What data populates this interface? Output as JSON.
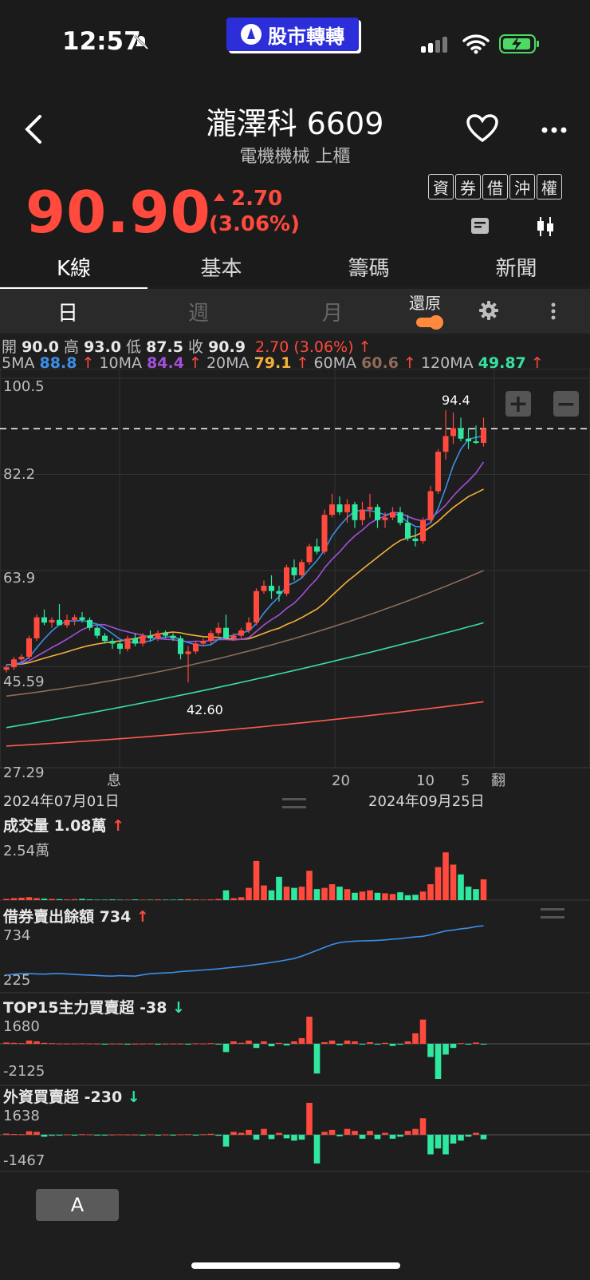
{
  "status_bar": {
    "time": "12:57"
  },
  "brand": {
    "text": "股市轉轉"
  },
  "stock": {
    "name_code": "瀧澤科 6609",
    "industry_market": "電機機械 上櫃",
    "price": "90.90",
    "change": "2.70",
    "change_pct": "(3.06%)"
  },
  "quick_tags": [
    "資",
    "券",
    "借",
    "沖",
    "權"
  ],
  "tabs": [
    "K線",
    "基本",
    "籌碼",
    "新聞"
  ],
  "period_tabs": [
    "日",
    "週",
    "月"
  ],
  "restore_label": "還原",
  "ohlc": {
    "open_label": "開",
    "open": "90.0",
    "high_label": "高",
    "high": "93.0",
    "low_label": "低",
    "low": "87.5",
    "close_label": "收",
    "close": "90.9",
    "change": "2.70 (3.06%)"
  },
  "ma": [
    {
      "label": "5MA",
      "value": "88.8",
      "color": "#3b8fe8"
    },
    {
      "label": "10MA",
      "value": "84.4",
      "color": "#a54fdc"
    },
    {
      "label": "20MA",
      "value": "79.1",
      "color": "#f4b13a"
    },
    {
      "label": "60MA",
      "value": "60.6",
      "color": "#8c6b58"
    },
    {
      "label": "120MA",
      "value": "49.87",
      "color": "#38e0a0"
    }
  ],
  "colors": {
    "up": "#ff4a3d",
    "down": "#2fe8a0"
  },
  "chart_data": [
    {
      "type": "candlestick",
      "y_ticks": [
        "100.5",
        "82.2",
        "63.9",
        "45.59",
        "27.29"
      ],
      "ylim": [
        27.29,
        100.5
      ],
      "x_labels": [
        "息",
        "20",
        "10",
        "5",
        "翻"
      ],
      "date_start": "2024年07月01日",
      "date_end": "2024年09月25日",
      "annotations": {
        "high": "94.4",
        "low": "42.60"
      },
      "candles": [
        [
          45.0,
          46.0,
          44.5,
          45.5
        ],
        [
          45.5,
          47.5,
          45.0,
          47.0
        ],
        [
          47.0,
          48.0,
          46.5,
          47.5
        ],
        [
          47.5,
          51.5,
          47.0,
          51.0
        ],
        [
          51.0,
          55.5,
          50.5,
          55.0
        ],
        [
          55.0,
          56.5,
          53.5,
          54.0
        ],
        [
          54.0,
          55.0,
          53.0,
          54.5
        ],
        [
          54.5,
          57.5,
          53.5,
          53.5
        ],
        [
          53.5,
          55.5,
          53.0,
          54.5
        ],
        [
          54.5,
          55.5,
          53.5,
          55.0
        ],
        [
          55.0,
          56.0,
          54.0,
          54.5
        ],
        [
          54.5,
          55.0,
          52.5,
          53.0
        ],
        [
          53.0,
          53.5,
          51.0,
          51.5
        ],
        [
          51.5,
          52.0,
          50.0,
          50.5
        ],
        [
          50.5,
          51.0,
          49.0,
          50.0
        ],
        [
          50.0,
          50.5,
          48.0,
          49.0
        ],
        [
          49.0,
          51.5,
          48.5,
          51.0
        ],
        [
          51.0,
          52.0,
          49.5,
          50.0
        ],
        [
          50.0,
          52.0,
          49.5,
          51.5
        ],
        [
          51.5,
          52.5,
          50.5,
          51.0
        ],
        [
          51.0,
          52.5,
          50.5,
          52.0
        ],
        [
          52.0,
          52.5,
          51.0,
          51.5
        ],
        [
          51.5,
          52.0,
          50.5,
          51.0
        ],
        [
          51.0,
          51.5,
          47.0,
          48.0
        ],
        [
          48.0,
          49.5,
          42.6,
          48.5
        ],
        [
          48.5,
          50.5,
          48.0,
          50.0
        ],
        [
          50.0,
          51.0,
          49.5,
          50.5
        ],
        [
          50.5,
          52.5,
          50.0,
          52.0
        ],
        [
          52.0,
          54.0,
          51.5,
          53.0
        ],
        [
          53.0,
          55.5,
          52.5,
          51.0
        ],
        [
          51.0,
          52.0,
          50.5,
          51.5
        ],
        [
          51.5,
          53.0,
          51.0,
          52.5
        ],
        [
          52.5,
          55.0,
          52.0,
          54.0
        ],
        [
          54.0,
          60.5,
          53.5,
          60.0
        ],
        [
          60.0,
          62.0,
          59.5,
          61.0
        ],
        [
          61.0,
          63.0,
          58.5,
          60.0
        ],
        [
          60.0,
          61.0,
          58.0,
          59.5
        ],
        [
          59.5,
          65.0,
          59.0,
          64.5
        ],
        [
          64.5,
          66.0,
          62.0,
          63.0
        ],
        [
          63.0,
          66.0,
          62.5,
          65.5
        ],
        [
          65.5,
          69.0,
          65.0,
          68.5
        ],
        [
          68.5,
          70.0,
          67.0,
          67.5
        ],
        [
          67.5,
          75.5,
          67.0,
          74.5
        ],
        [
          74.5,
          78.5,
          74.0,
          76.5
        ],
        [
          76.5,
          78.0,
          74.5,
          75.0
        ],
        [
          75.0,
          77.5,
          73.0,
          76.5
        ],
        [
          76.5,
          77.0,
          72.0,
          73.5
        ],
        [
          73.5,
          77.0,
          72.5,
          75.5
        ],
        [
          75.5,
          78.5,
          74.0,
          76.0
        ],
        [
          76.0,
          76.5,
          72.0,
          73.5
        ],
        [
          73.5,
          75.0,
          72.0,
          74.0
        ],
        [
          74.0,
          76.0,
          73.5,
          75.0
        ],
        [
          75.0,
          76.0,
          72.5,
          73.0
        ],
        [
          73.0,
          74.5,
          69.5,
          70.0
        ],
        [
          70.0,
          72.0,
          68.5,
          69.5
        ],
        [
          69.5,
          74.0,
          69.0,
          73.5
        ],
        [
          73.5,
          80.0,
          73.0,
          79.0
        ],
        [
          79.0,
          87.0,
          78.5,
          86.5
        ],
        [
          86.5,
          94.4,
          85.0,
          89.5
        ],
        [
          89.5,
          94.0,
          88.0,
          91.0
        ],
        [
          91.0,
          93.0,
          88.5,
          89.0
        ],
        [
          89.0,
          91.0,
          87.0,
          88.5
        ],
        [
          88.5,
          91.5,
          88.0,
          88.2
        ],
        [
          88.2,
          93.0,
          87.5,
          90.9
        ]
      ]
    },
    {
      "type": "bar",
      "title": "成交量",
      "value": "1.08萬",
      "ymax_label": "2.54萬",
      "ylim": [
        0,
        2.54
      ],
      "values": [
        0.05,
        0.08,
        0.1,
        0.12,
        0.08,
        0.06,
        0.05,
        0.04,
        0.03,
        0.04,
        0.05,
        0.03,
        0.02,
        0.02,
        0.03,
        0.02,
        0.02,
        0.03,
        0.02,
        0.02,
        0.03,
        0.02,
        0.02,
        0.03,
        0.04,
        0.03,
        0.02,
        0.03,
        0.05,
        0.4,
        0.08,
        0.12,
        0.5,
        1.6,
        0.6,
        0.4,
        0.95,
        0.55,
        0.5,
        0.55,
        1.2,
        0.45,
        0.5,
        0.65,
        0.55,
        0.45,
        0.3,
        0.35,
        0.4,
        0.3,
        0.28,
        0.25,
        0.32,
        0.2,
        0.22,
        0.35,
        0.65,
        1.35,
        1.95,
        1.45,
        1.05,
        0.55,
        0.45,
        0.85
      ]
    },
    {
      "type": "line",
      "title": "借券賣出餘額",
      "value": "734",
      "ymax_label": "734",
      "ymin_label": "225",
      "ylim": [
        225,
        734
      ],
      "values": [
        225,
        235,
        240,
        242,
        238,
        236,
        240,
        242,
        238,
        232,
        228,
        226,
        222,
        218,
        215,
        220,
        218,
        215,
        228,
        240,
        245,
        248,
        252,
        262,
        268,
        272,
        278,
        284,
        290,
        298,
        306,
        314,
        324,
        334,
        344,
        356,
        368,
        382,
        396,
        420,
        450,
        480,
        510,
        540,
        560,
        570,
        575,
        578,
        580,
        583,
        588,
        596,
        600,
        612,
        618,
        625,
        640,
        660,
        680,
        690,
        702,
        710,
        724,
        734
      ]
    },
    {
      "type": "bar",
      "title": "TOP15主力買賣超",
      "value": "-38",
      "ymax_label": "1680",
      "ymin_label": "-2125",
      "ylim": [
        -2125,
        1680
      ],
      "values": [
        80,
        60,
        40,
        200,
        150,
        60,
        40,
        20,
        15,
        20,
        30,
        20,
        10,
        -10,
        15,
        10,
        -10,
        5,
        10,
        20,
        -20,
        10,
        15,
        10,
        -10,
        30,
        20,
        40,
        -30,
        -500,
        150,
        60,
        200,
        -250,
        150,
        -150,
        60,
        -100,
        150,
        350,
        1680,
        -1800,
        100,
        200,
        -80,
        200,
        150,
        -30,
        100,
        -50,
        60,
        -130,
        -40,
        150,
        650,
        1500,
        -800,
        -2125,
        -650,
        -250,
        40,
        -50,
        80,
        -38
      ]
    },
    {
      "type": "bar",
      "title": "外資買賣超",
      "value": "-230",
      "ymax_label": "1638",
      "ymin_label": "-1467",
      "ylim": [
        -1467,
        1638
      ],
      "values": [
        60,
        40,
        30,
        180,
        150,
        -100,
        -50,
        -30,
        20,
        -20,
        30,
        20,
        -10,
        -20,
        10,
        20,
        15,
        10,
        -10,
        20,
        -20,
        15,
        -10,
        20,
        30,
        -40,
        30,
        50,
        -50,
        -600,
        150,
        100,
        250,
        -250,
        300,
        -220,
        100,
        -180,
        -300,
        -250,
        1638,
        -1467,
        150,
        250,
        -80,
        300,
        200,
        -200,
        200,
        -220,
        100,
        -200,
        -100,
        200,
        300,
        850,
        -1000,
        -700,
        -1000,
        -450,
        -300,
        -100,
        100,
        -230
      ]
    }
  ],
  "volume": {
    "title": "成交量",
    "value": "1.08萬",
    "ymax": "2.54萬"
  },
  "short_balance": {
    "title": "借券賣出餘額",
    "value": "734",
    "ymax": "734",
    "ymin": "225"
  },
  "main_force": {
    "title": "TOP15主力買賣超",
    "value": "-38",
    "ymax": "1680",
    "ymin": "-2125"
  },
  "foreign": {
    "title": "外資買賣超",
    "value": "-230",
    "ymax": "1638",
    "ymin": "-1467"
  },
  "font_button": "A"
}
